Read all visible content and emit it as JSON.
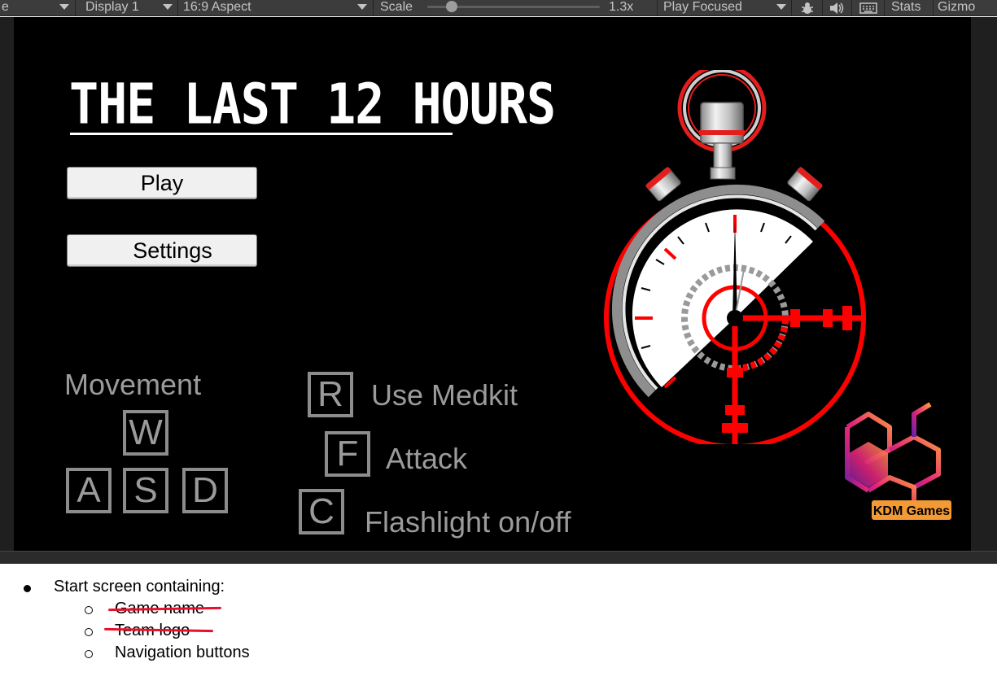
{
  "toolbar": {
    "left_fragment": "e",
    "display": "Display 1",
    "aspect": "16:9 Aspect",
    "scale_label": "Scale",
    "scale_value": "1.3x",
    "play_mode": "Play Focused",
    "stats": "Stats",
    "gizmos": "Gizmo"
  },
  "game": {
    "title": "THE LAST 12 HOURS",
    "buttons": {
      "play": "Play",
      "settings": "Settings"
    },
    "controls": {
      "movement_label": "Movement",
      "keys": {
        "w": "W",
        "a": "A",
        "s": "S",
        "d": "D",
        "r": "R",
        "f": "F",
        "c": "C"
      },
      "medkit": "Use Medkit",
      "attack": "Attack",
      "flashlight": "Flashlight on/off"
    },
    "logo_text": "KDM Games",
    "colors": {
      "background": "#000000",
      "accent": "#ff0000",
      "control_gray": "#9b9b9b"
    }
  },
  "notes": {
    "main": "Start screen containing:",
    "items": [
      "Game name",
      "Team logo",
      "Navigation buttons"
    ],
    "strike_color": "#e8102a"
  }
}
